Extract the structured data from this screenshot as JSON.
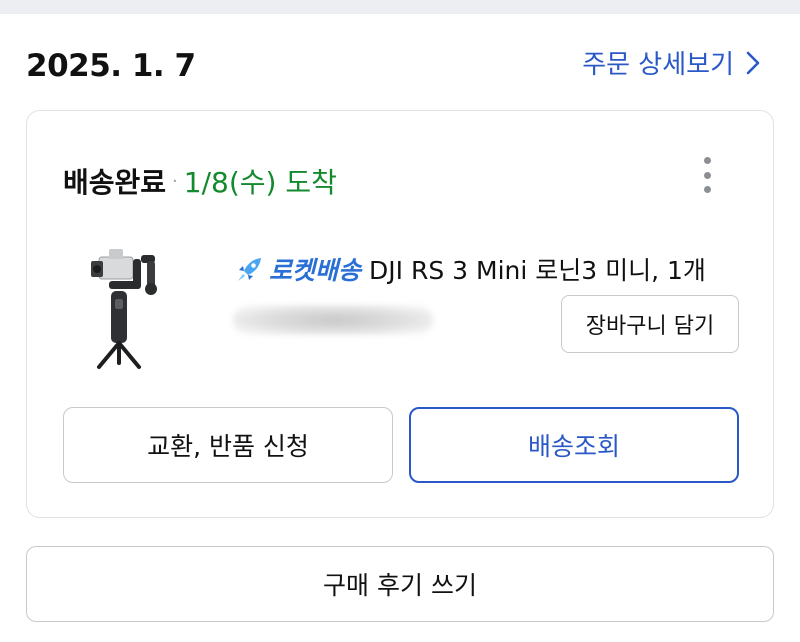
{
  "order": {
    "date": "2025. 1. 7",
    "detail_link_label": "주문 상세보기"
  },
  "shipment": {
    "status_label": "배송완료",
    "separator": "·",
    "arrival_text": "1/8(수) 도착"
  },
  "product": {
    "delivery_badge": "로켓배송",
    "title": "DJI RS 3 Mini 로닌3 미니, 1개",
    "image_icon": "camera-gimbal-icon"
  },
  "buttons": {
    "add_to_cart": "장바구니 담기",
    "exchange_return": "교환, 반품 신청",
    "track_delivery": "배송조회",
    "write_review": "구매 후기 쓰기"
  },
  "colors": {
    "accent_blue": "#2a59c7",
    "rocket_blue": "#2a6fd6",
    "arrival_green": "#138a2e"
  },
  "icons": {
    "detail": "chevron-right-icon",
    "more": "more-vertical-icon",
    "rocket": "rocket-icon"
  }
}
